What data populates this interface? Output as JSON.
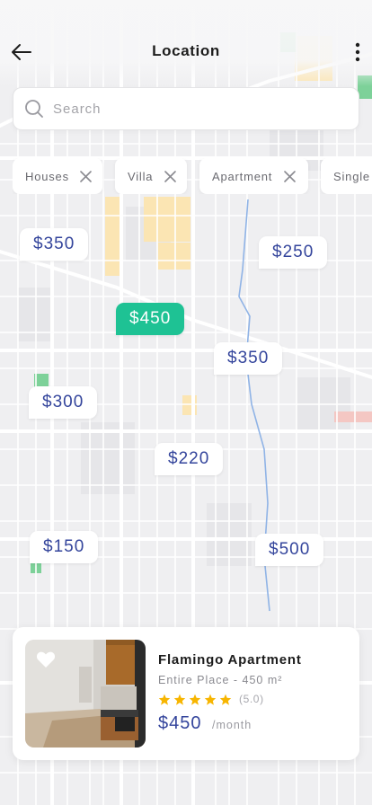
{
  "header": {
    "title": "Location"
  },
  "search": {
    "placeholder": "Search",
    "value": ""
  },
  "filters": [
    {
      "label": "Houses"
    },
    {
      "label": "Villa"
    },
    {
      "label": "Apartment"
    },
    {
      "label": "Single"
    }
  ],
  "markers": [
    {
      "label": "$350",
      "active": false
    },
    {
      "label": "$250",
      "active": false
    },
    {
      "label": "$450",
      "active": true
    },
    {
      "label": "$350",
      "active": false
    },
    {
      "label": "$300",
      "active": false
    },
    {
      "label": "$220",
      "active": false
    },
    {
      "label": "$150",
      "active": false
    },
    {
      "label": "$500",
      "active": false
    }
  ],
  "property": {
    "name": "Flamingo Apartment",
    "subtitle": "Entire Place - 450 m²",
    "stars": 5,
    "rating": "(5.0)",
    "price": "$450",
    "unit": "/month",
    "favorited": true
  },
  "colors": {
    "accent_green": "#1ec294",
    "price_blue": "#34459c",
    "star_yellow": "#f7b500",
    "map_background": "#efeff1",
    "map_road": "#ffffff",
    "map_park": "#7dd199",
    "map_zone": "#fbe5b3",
    "map_water": "#8fb3e6"
  },
  "icons": {
    "back": "arrow-left-icon",
    "more": "more-vertical-icon",
    "search": "search-icon",
    "remove_filter": "close-icon",
    "favorite": "heart-icon",
    "star": "star-icon"
  }
}
